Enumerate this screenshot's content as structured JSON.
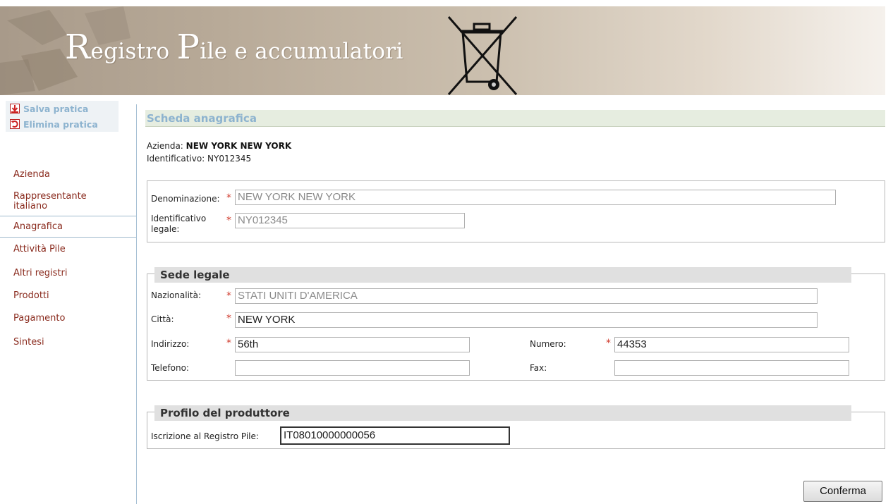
{
  "banner": {
    "title_cap1": "R",
    "title_rest1": "egistro ",
    "title_cap2": "P",
    "title_rest2": "ile e accumulatori"
  },
  "sidebar": {
    "actions": [
      {
        "label": "Salva pratica",
        "icon": "save-icon"
      },
      {
        "label": "Elimina pratica",
        "icon": "undo-delete-icon"
      }
    ],
    "nav": [
      {
        "label": "Azienda"
      },
      {
        "label": "Rappresentante italiano"
      },
      {
        "label": "Anagrafica",
        "active": true
      },
      {
        "label": "Attività Pile"
      },
      {
        "label": "Altri registri"
      },
      {
        "label": "Prodotti"
      },
      {
        "label": "Pagamento"
      },
      {
        "label": "Sintesi"
      }
    ]
  },
  "main": {
    "section_title": "Scheda anagrafica",
    "company_label": "Azienda: ",
    "company_name": "NEW YORK NEW YORK",
    "identifier_label": "Identificativo: ",
    "identifier_value": "NY012345",
    "identity": {
      "denominazione_label": "Denominazione:",
      "denominazione_value": "NEW YORK NEW YORK",
      "id_legale_label": "Identificativo legale:",
      "id_legale_value": "NY012345"
    },
    "sede": {
      "legend": "Sede legale",
      "nazionalita_label": "Nazionalità:",
      "nazionalita_value": "STATI UNITI D'AMERICA",
      "citta_label": "Città:",
      "citta_value": "NEW YORK",
      "indirizzo_label": "Indirizzo:",
      "indirizzo_value": "56th",
      "numero_label": "Numero:",
      "numero_value": "44353",
      "telefono_label": "Telefono:",
      "telefono_value": "",
      "fax_label": "Fax:",
      "fax_value": ""
    },
    "profilo": {
      "legend": "Profilo del produttore",
      "iscrizione_label": "Iscrizione al Registro Pile:",
      "iscrizione_value": "IT08010000000056"
    },
    "required_mark": "*",
    "confirm_label": "Conferma"
  },
  "colors": {
    "nav_text": "#8a2b1e",
    "action_text": "#8db3cf",
    "section_head_bg": "#e6ede0",
    "required": "#d03a2c"
  }
}
